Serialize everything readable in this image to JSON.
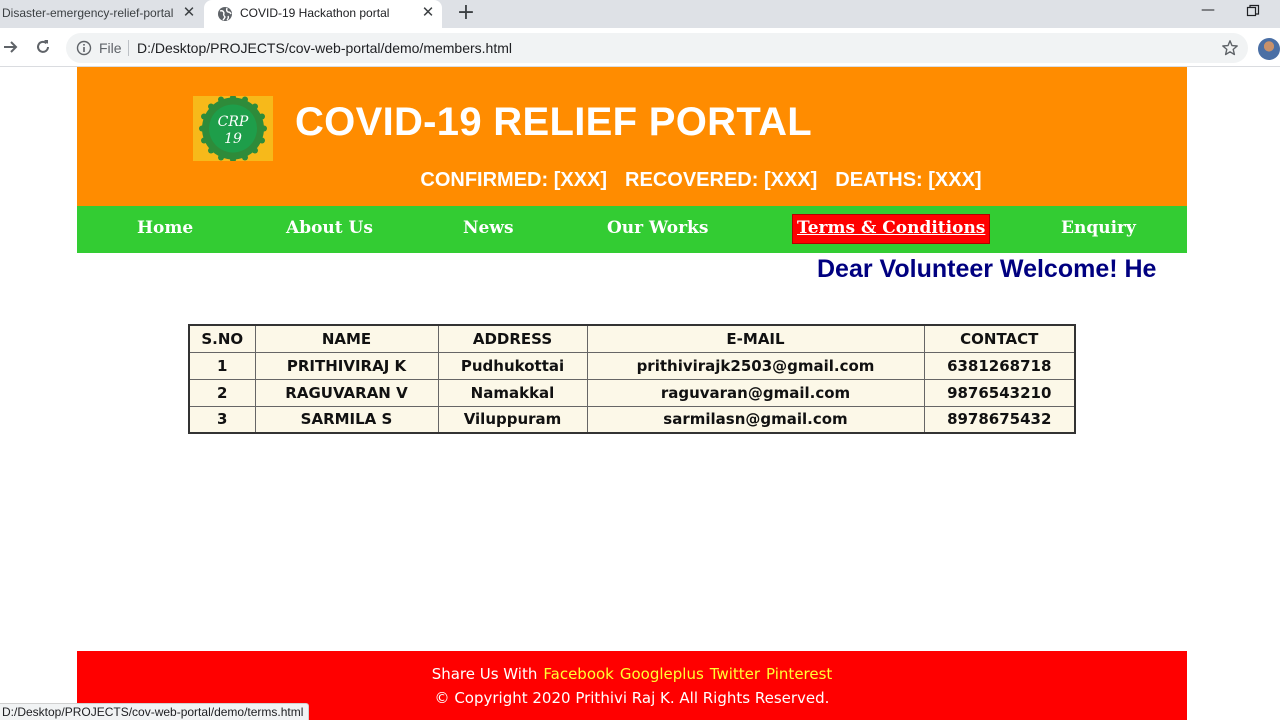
{
  "browser": {
    "tabs": [
      {
        "title": "Disaster-emergency-relief-portal",
        "active": false,
        "close": "✕"
      },
      {
        "title": "COVID-19 Hackathon portal",
        "active": true,
        "icon": "globe-icon",
        "close": "✕"
      }
    ],
    "new_tab": "+",
    "window_min": "—",
    "omnibox": {
      "scheme_label": "File",
      "url": "D:/Desktop/PROJECTS/cov-web-portal/demo/members.html"
    },
    "status_url": "D:/Desktop/PROJECTS/cov-web-portal/demo/terms.html"
  },
  "header": {
    "logo_text": [
      "CRP",
      "19"
    ],
    "title": "COVID-19 RELIEF PORTAL",
    "stats": {
      "confirmed": "CONFIRMED: [XXX]",
      "recovered": "RECOVERED: [XXX]",
      "deaths": "DEATHS: [XXX]"
    }
  },
  "nav": {
    "items": [
      {
        "label": "Home"
      },
      {
        "label": "About Us"
      },
      {
        "label": "News"
      },
      {
        "label": "Our Works"
      },
      {
        "label": "Terms & Conditions"
      },
      {
        "label": "Enquiry"
      }
    ]
  },
  "marquee": {
    "text": "Dear Volunteer Welcome! He"
  },
  "table": {
    "headers": [
      "S.NO",
      "NAME",
      "ADDRESS",
      "E-MAIL",
      "CONTACT"
    ],
    "rows": [
      [
        "1",
        "PRITHIVIRAJ K",
        "Pudhukottai",
        "prithivirajk2503@gmail.com",
        "6381268718"
      ],
      [
        "2",
        "RAGUVARAN V",
        "Namakkal",
        "raguvaran@gmail.com",
        "9876543210"
      ],
      [
        "3",
        "SARMILA S",
        "Viluppuram",
        "sarmilasn@gmail.com",
        "8978675432"
      ]
    ]
  },
  "footer": {
    "share_prefix": "Share Us With",
    "share_links": [
      "Facebook",
      "Googleplus",
      "Twitter",
      "Pinterest"
    ],
    "copyright": "© Copyright 2020 Prithivi Raj K. All Rights Reserved."
  },
  "colors": {
    "banner": "#ff8c00",
    "navbar": "#33cc33",
    "active_nav": "#ff0000",
    "marquee_text": "#000080",
    "footer": "#ff0000",
    "footer_link": "#ffff33",
    "table_bg": "#fcf8e8"
  }
}
